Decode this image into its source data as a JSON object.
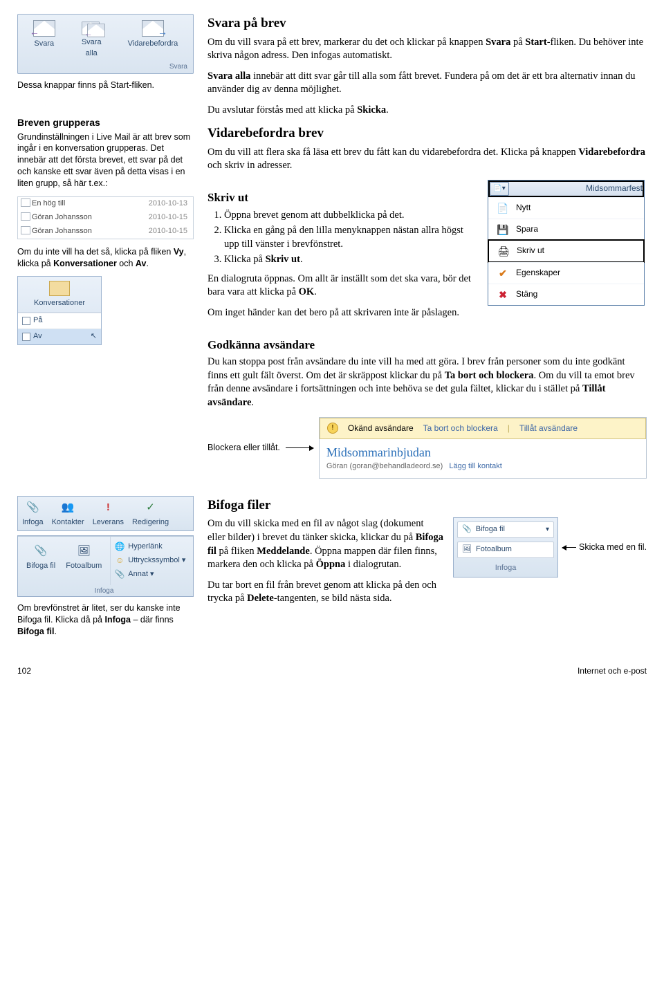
{
  "sidebar": {
    "reply_buttons": {
      "svara": "Svara",
      "svara_alla": "Svara\nalla",
      "vidarebefordra": "Vidarebefordra",
      "group": "Svara"
    },
    "caption1": "Dessa knappar finns på Start-fliken.",
    "group_heading": "Breven grupperas",
    "group_text": "Grundinställningen i Live Mail är att brev som ingår i en konversation grupperas. Det innebär att det första brevet, ett svar på det och kanske ett svar även på detta visas i en liten grupp, så här t.ex.:",
    "conv_list": [
      {
        "name": "En hög till",
        "date": "2010-10-13"
      },
      {
        "name": "Göran Johansson",
        "date": "2010-10-15"
      },
      {
        "name": "Göran Johansson",
        "date": "2010-10-15"
      }
    ],
    "group_text2_pre": "Om du inte vill ha det så, klicka på fliken ",
    "group_text2_b1": "Vy",
    "group_text2_mid": ", klicka på ",
    "group_text2_b2": "Konversationer",
    "group_text2_mid2": " och ",
    "group_text2_b3": "Av",
    "group_text2_post": ".",
    "conv_panel": {
      "title": "Konversationer",
      "on": "På",
      "off": "Av"
    }
  },
  "main": {
    "h_reply": "Svara på brev",
    "p_reply1": "Om du vill svara på ett brev, markerar du det och klickar på knappen Svara på Start-fliken. Du behöver inte skriva någon adress. Den infogas automatiskt.",
    "p_reply2": "Svara alla innebär att ditt svar går till alla som fått brevet. Fundera på om det är ett bra alternativ innan du använder dig av denna möjlighet.",
    "p_reply3": "Du avslutar förstås med att klicka på Skicka.",
    "h_forward": "Vidarebefordra brev",
    "p_forward": "Om du vill att flera ska få läsa ett brev du fått kan du vidarebefordra det. Klicka på knappen Vidarebefordra och skriv in adresser.",
    "h_print": "Skriv ut",
    "ol_print": [
      "Öppna brevet genom att dubbelklicka på det.",
      "Klicka en gång på den lilla menyknappen nästan allra högst upp till vänster i brevfönstret.",
      "Klicka på Skriv ut."
    ],
    "p_print1": "En dialogruta öppnas. Om allt är inställt som det ska vara, bör det bara vara att klicka på OK.",
    "p_print2": "Om inget händer kan det bero på att skrivaren inte är påslagen.",
    "menu": {
      "title": "Midsommarfest",
      "items": [
        {
          "icon": "📄",
          "label": "Nytt"
        },
        {
          "icon": "💾",
          "label": "Spara"
        },
        {
          "icon": "🖨",
          "label": "Skriv ut"
        },
        {
          "icon": "✔",
          "label": "Egenskaper",
          "color": "#d97a1a"
        },
        {
          "icon": "✖",
          "label": "Stäng",
          "color": "#c23"
        }
      ]
    },
    "h_approve": "Godkänna avsändare",
    "p_approve": "Du kan stoppa post från avsändare du inte vill ha med att göra. I brev från personer som du inte godkänt finns ett gult fält överst. Om det är skräppost klickar du på Ta bort och blockera. Om du vill  ta emot brev från denne avsändare i fortsättningen och inte behöva se det gula fältet, klickar du i stället på Tillåt avsändare.",
    "block_caption": "Blockera eller tillåt.",
    "yellowbar": {
      "unknown": "Okänd avsändare",
      "remove": "Ta bort och blockera",
      "allow": "Tillåt avsändare"
    },
    "msg": {
      "title": "Midsommarinbjudan",
      "from": "Göran (goran@behandladeord.se)",
      "add": "Lägg till kontakt"
    }
  },
  "lower_left": {
    "insert_top": [
      "Infoga",
      "Kontakter",
      "Leverans",
      "Redigering"
    ],
    "insert_icons": [
      "📎",
      "👥",
      "!",
      "✓"
    ],
    "insert_bottom_left": [
      "Bifoga fil",
      "Fotoalbum"
    ],
    "insert_bottom_right": [
      "Hyperlänk",
      "Uttryckssymbol ▾",
      "Annat ▾"
    ],
    "insert_group": "Infoga",
    "caption": "Om brevfönstret är litet, ser du kanske inte Bifoga fil. Klicka då på Infoga – där finns Bifoga fil."
  },
  "lower_right": {
    "h": "Bifoga filer",
    "p1": "Om du vill skicka med en fil av något slag (dokument eller bilder) i brevet du tänker skicka, klickar du på Bifoga fil på fliken Meddelande. Öppna mappen där filen finns, markera den och klicka på Öppna i dialogrutan.",
    "p2": "Du tar bort en fil från brevet genom att klicka på den och trycka på Delete-tangenten, se bild nästa sida.",
    "bif_panel": {
      "b1": "Bifoga fil",
      "b2": "Fotoalbum",
      "group": "Infoga"
    },
    "arrow_caption": "Skicka med en fil."
  },
  "footer": {
    "page": "102",
    "title": "Internet och e-post"
  }
}
